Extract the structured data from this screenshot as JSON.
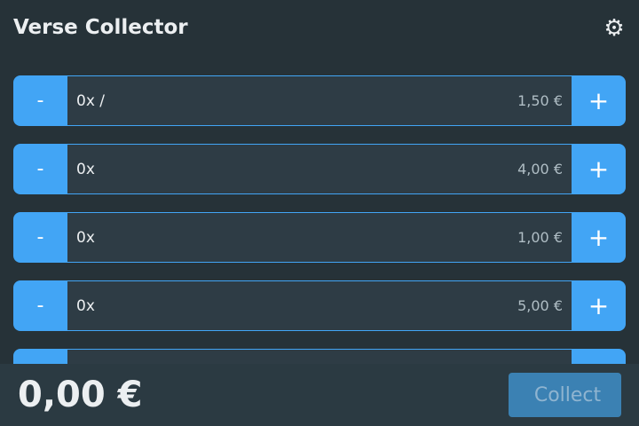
{
  "app": {
    "title": "Verse Collector",
    "settings_icon": "⚙"
  },
  "items": [
    {
      "label": "0x /",
      "price": "1,50 €",
      "minus": "-",
      "plus": "+"
    },
    {
      "label": "0x ",
      "price": "4,00 €",
      "minus": "-",
      "plus": "+"
    },
    {
      "label": "0x ",
      "price": "1,00 €",
      "minus": "-",
      "plus": "+"
    },
    {
      "label": "0x ",
      "price": "5,00 €",
      "minus": "-",
      "plus": "+"
    },
    {
      "label": "",
      "price": "",
      "minus": "-",
      "plus": "+"
    }
  ],
  "footer": {
    "total": "0,00 €",
    "collect_icon": "",
    "collect_label": "Collect"
  },
  "colors": {
    "background": "#263238",
    "accent": "#42a5f5",
    "row_background": "#2e3c45",
    "footer_background": "#2b3a42",
    "collect_button": "#3b81b3"
  }
}
